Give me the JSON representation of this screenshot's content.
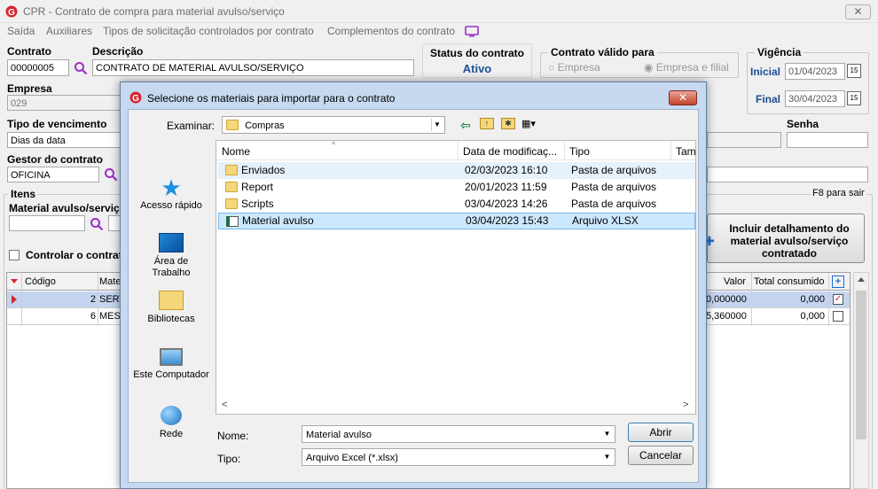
{
  "window": {
    "title": "CPR - Contrato de compra para material avulso/serviço"
  },
  "menu": {
    "items": [
      "Saída",
      "Auxiliares",
      "Tipos de solicitação controlados por contrato",
      "Complementos do contrato"
    ]
  },
  "contrato": {
    "label": "Contrato",
    "value": "00000005"
  },
  "descricao": {
    "label": "Descrição",
    "value": "CONTRATO DE MATERIAL AVULSO/SERVIÇO"
  },
  "status": {
    "title": "Status do contrato",
    "value": "Ativo"
  },
  "valido": {
    "title": "Contrato válido para",
    "opt1": "Empresa",
    "opt2": "Empresa e filial"
  },
  "vigencia": {
    "title": "Vigência",
    "inicial_label": "Inicial",
    "inicial": "01/04/2023",
    "final_label": "Final",
    "final": "30/04/2023"
  },
  "empresa": {
    "label": "Empresa",
    "value": "029"
  },
  "vencimento": {
    "label": "Tipo de vencimento",
    "value": "Dias da data"
  },
  "senha": {
    "label": "Senha"
  },
  "gestor": {
    "label": "Gestor do contrato",
    "value": "OFICINA"
  },
  "itens": {
    "title": "Itens",
    "hint": "F8 para sair",
    "material_label": "Material avulso/serviç",
    "controlar": "Controlar o contrat",
    "incluir_btn": "Incluir detalhamento do material avulso/serviço contratado"
  },
  "grid": {
    "headers": {
      "codigo": "Código",
      "mat": "Mate",
      "valor": "Valor",
      "total": "Total consumido"
    },
    "rows": [
      {
        "codigo": "2",
        "mat": "SERV",
        "valor": "0,000000",
        "total": "0,000"
      },
      {
        "codigo": "6",
        "mat": "MESA",
        "valor": "5,360000",
        "total": "0,000"
      }
    ]
  },
  "dialog": {
    "title": "Selecione os materiais para importar para o contrato",
    "examinar_label": "Examinar:",
    "examinar_value": "Compras",
    "places": [
      "Acesso rápido",
      "Área de Trabalho",
      "Bibliotecas",
      "Este Computador",
      "Rede"
    ],
    "columns": {
      "nome": "Nome",
      "data": "Data de modificaç...",
      "tipo": "Tipo",
      "tam": "Tam"
    },
    "files": [
      {
        "nome": "Enviados",
        "data": "02/03/2023 16:10",
        "tipo": "Pasta de arquivos"
      },
      {
        "nome": "Report",
        "data": "20/01/2023 11:59",
        "tipo": "Pasta de arquivos"
      },
      {
        "nome": "Scripts",
        "data": "03/04/2023 14:26",
        "tipo": "Pasta de arquivos"
      },
      {
        "nome": "Material avulso",
        "data": "03/04/2023 15:43",
        "tipo": "Arquivo XLSX"
      }
    ],
    "nome_label": "Nome:",
    "nome_value": "Material avulso",
    "tipo_label": "Tipo:",
    "tipo_value": "Arquivo Excel (*.xlsx)",
    "abrir": "Abrir",
    "cancelar": "Cancelar"
  }
}
